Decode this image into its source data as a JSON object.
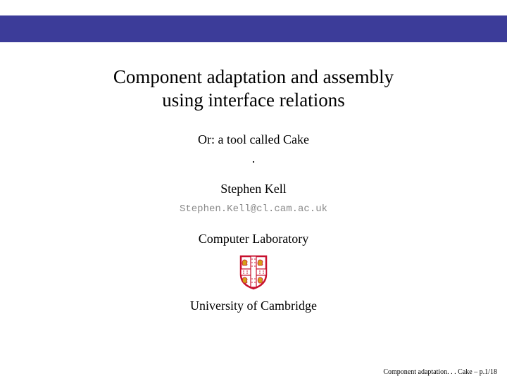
{
  "title": {
    "line1": "Component adaptation and assembly",
    "line2": "using interface relations"
  },
  "subtitle": "Or: a tool called Cake",
  "dot": ".",
  "author": "Stephen Kell",
  "email": "Stephen.Kell@cl.cam.ac.uk",
  "lab": "Computer Laboratory",
  "university": "University of Cambridge",
  "footer": "Component adaptation. . .   Cake – p.1/18",
  "colors": {
    "header": "#3c3c99",
    "crest_red": "#c8102e",
    "crest_gold": "#d4a017"
  }
}
